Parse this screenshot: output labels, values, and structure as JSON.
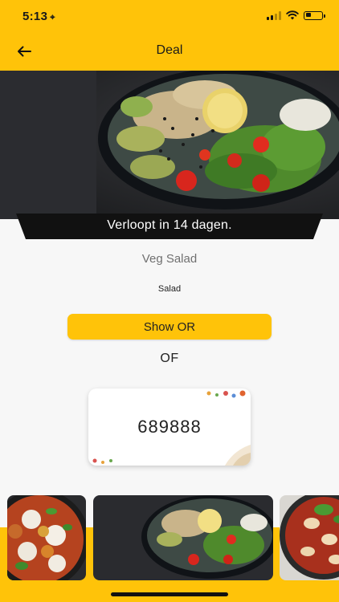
{
  "status_bar": {
    "time": "5:13",
    "location_glyph": "⌖"
  },
  "nav": {
    "title": "Deal",
    "back_icon": "arrow-left-icon"
  },
  "deal": {
    "expiry_text": "Verloopt in 14 dagen.",
    "title": "Veg Salad",
    "category": "Salad",
    "show_button_label": "Show OR",
    "separator": "OF",
    "code": "689888"
  },
  "colors": {
    "accent": "#ffc309",
    "banner": "#111111",
    "background": "#f7f7f7"
  }
}
